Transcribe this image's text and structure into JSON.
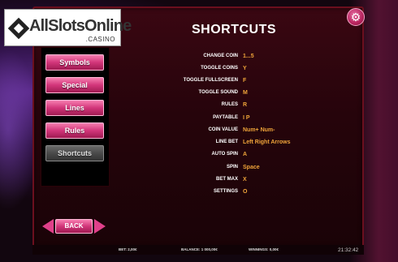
{
  "logo": {
    "text": "AllSlotsOnline",
    "sub": ".CASINO"
  },
  "settings": {
    "icon": "gear-icon"
  },
  "title": "SHORTCUTS",
  "sidebar": {
    "items": [
      {
        "label": "Symbols",
        "active": false
      },
      {
        "label": "Special",
        "active": false
      },
      {
        "label": "Lines",
        "active": false
      },
      {
        "label": "Rules",
        "active": false
      },
      {
        "label": "Shortcuts",
        "active": true
      }
    ]
  },
  "back": {
    "label": "BACK"
  },
  "shortcuts": [
    {
      "label": "CHANGE COIN",
      "value": "1...5"
    },
    {
      "label": "TOGGLE COINS",
      "value": "Y"
    },
    {
      "label": "TOGGLE FULLSCREEN",
      "value": "F"
    },
    {
      "label": "TOGGLE SOUND",
      "value": "M"
    },
    {
      "label": "RULES",
      "value": "R"
    },
    {
      "label": "PAYTABLE",
      "value": "I P"
    },
    {
      "label": "COIN VALUE",
      "value": "Num+ Num-"
    },
    {
      "label": "LINE BET",
      "value": "Left Right Arrows"
    },
    {
      "label": "AUTO SPIN",
      "value": "A"
    },
    {
      "label": "SPIN",
      "value": "Space"
    },
    {
      "label": "BET MAX",
      "value": "X"
    },
    {
      "label": "SETTINGS",
      "value": "O"
    }
  ],
  "status": {
    "bet": "BET: 2,00€",
    "balance": "BALANCE: 1 000,00€",
    "winnings": "WINNINGS: 0,00€",
    "time": "21:32:42"
  }
}
